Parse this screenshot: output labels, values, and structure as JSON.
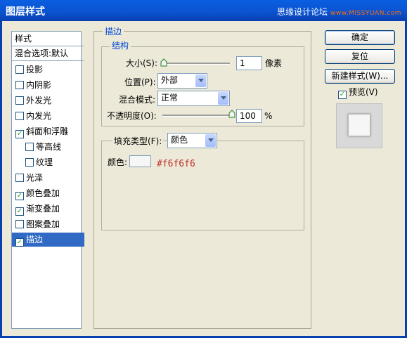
{
  "titlebar": {
    "title": "图层样式",
    "watermark_text": "思缘设计论坛",
    "watermark_url": "www.MISSYUAN.com"
  },
  "sidebar": {
    "header": "样式",
    "blend_options": "混合选项:默认",
    "items": [
      {
        "label": "投影",
        "checked": false
      },
      {
        "label": "内阴影",
        "checked": false
      },
      {
        "label": "外发光",
        "checked": false
      },
      {
        "label": "内发光",
        "checked": false
      },
      {
        "label": "斜面和浮雕",
        "checked": true
      },
      {
        "label": "等高线",
        "checked": false
      },
      {
        "label": "纹理",
        "checked": false
      },
      {
        "label": "光泽",
        "checked": false
      },
      {
        "label": "颜色叠加",
        "checked": true
      },
      {
        "label": "渐变叠加",
        "checked": true
      },
      {
        "label": "图案叠加",
        "checked": false
      },
      {
        "label": "描边",
        "checked": true
      }
    ]
  },
  "stroke": {
    "title": "描边",
    "structure_title": "结构",
    "size_label": "大小(S):",
    "size_value": "1",
    "size_unit": "像素",
    "size_fraction": 0.0,
    "position_label": "位置(P):",
    "position_value": "外部",
    "blend_mode_label": "混合模式:",
    "blend_mode_value": "正常",
    "opacity_label": "不透明度(O):",
    "opacity_value": "100",
    "opacity_unit": "%",
    "opacity_fraction": 1.0,
    "fill_type_label": "填充类型(F):",
    "fill_type_value": "颜色",
    "color_label": "颜色:",
    "color_hex": "#f6f6f6"
  },
  "buttons": {
    "ok": "确定",
    "reset": "复位",
    "new_style": "新建样式(W)...",
    "preview_label": "预览(V)",
    "preview_checked": true
  },
  "colors": {
    "accent": "#316ac5",
    "title_bar": "#0a5fe0",
    "annotation": "#c0302a"
  }
}
